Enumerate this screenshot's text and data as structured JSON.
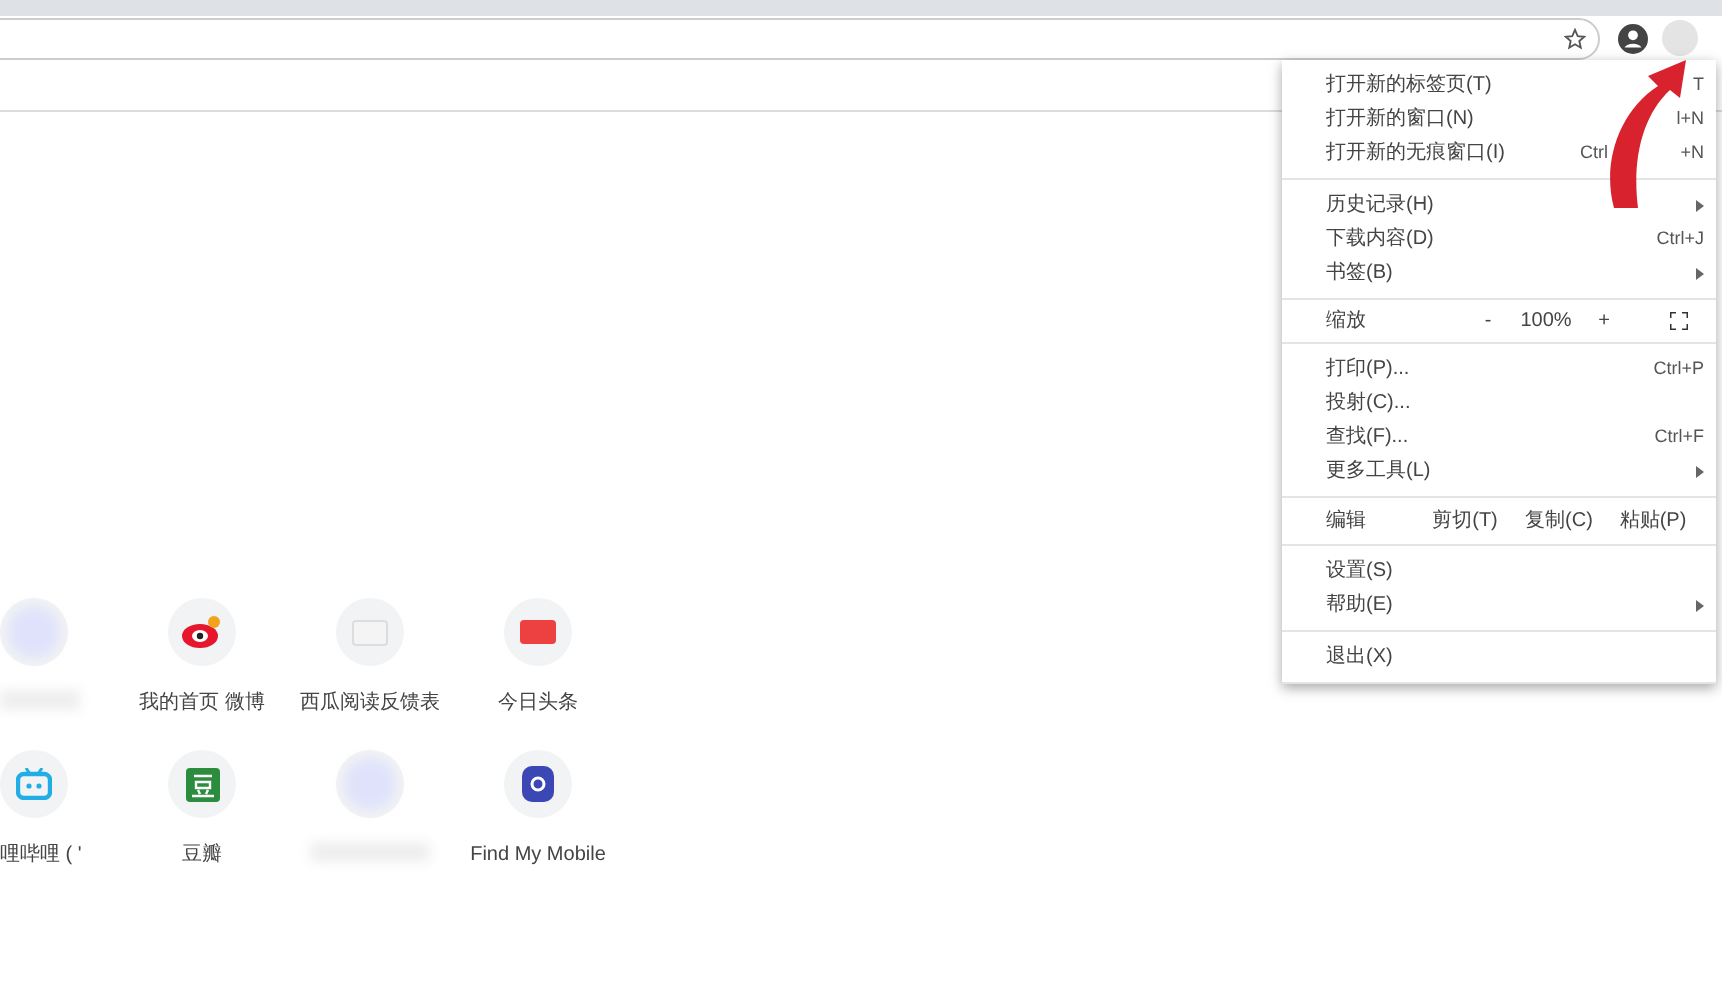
{
  "menu": {
    "groups": [
      [
        {
          "label": "打开新的标签页(T)",
          "shortcut": [
            "T"
          ],
          "submenu": false
        },
        {
          "label": "打开新的窗口(N)",
          "shortcut": [
            "l+N"
          ],
          "submenu": false
        },
        {
          "label": "打开新的无痕窗口(I)",
          "shortcut": [
            "Ctrl",
            "+N"
          ],
          "submenu": false
        }
      ],
      [
        {
          "label": "历史记录(H)",
          "submenu": true
        },
        {
          "label": "下载内容(D)",
          "shortcut": [
            "Ctrl+J"
          ],
          "submenu": false
        },
        {
          "label": "书签(B)",
          "submenu": true
        }
      ]
    ],
    "zoom": {
      "label": "缩放",
      "minus": "-",
      "value": "100%",
      "plus": "+"
    },
    "groups2": [
      [
        {
          "label": "打印(P)...",
          "shortcut": [
            "Ctrl+P"
          ],
          "submenu": false
        },
        {
          "label": "投射(C)...",
          "submenu": false
        },
        {
          "label": "查找(F)...",
          "shortcut": [
            "Ctrl+F"
          ],
          "submenu": false
        },
        {
          "label": "更多工具(L)",
          "submenu": true
        }
      ]
    ],
    "edit": {
      "label": "编辑",
      "actions": [
        "剪切(T)",
        "复制(C)",
        "粘贴(P)"
      ]
    },
    "groups3": [
      [
        {
          "label": "设置(S)",
          "submenu": false
        },
        {
          "label": "帮助(E)",
          "submenu": true
        }
      ],
      [
        {
          "label": "退出(X)",
          "submenu": false
        }
      ]
    ]
  },
  "shortcuts": [
    {
      "kind": "blurred"
    },
    {
      "kind": "weibo",
      "label": "我的首页 微博"
    },
    {
      "kind": "page",
      "label": "西瓜阅读反馈表"
    },
    {
      "kind": "toutiao",
      "label": "今日头条"
    },
    {
      "kind": "bilibili",
      "label": "哩哔哩 ( '"
    },
    {
      "kind": "douban",
      "label": "豆瓣"
    },
    {
      "kind": "blurred"
    },
    {
      "kind": "findmobile",
      "label": "Find My Mobile"
    }
  ]
}
